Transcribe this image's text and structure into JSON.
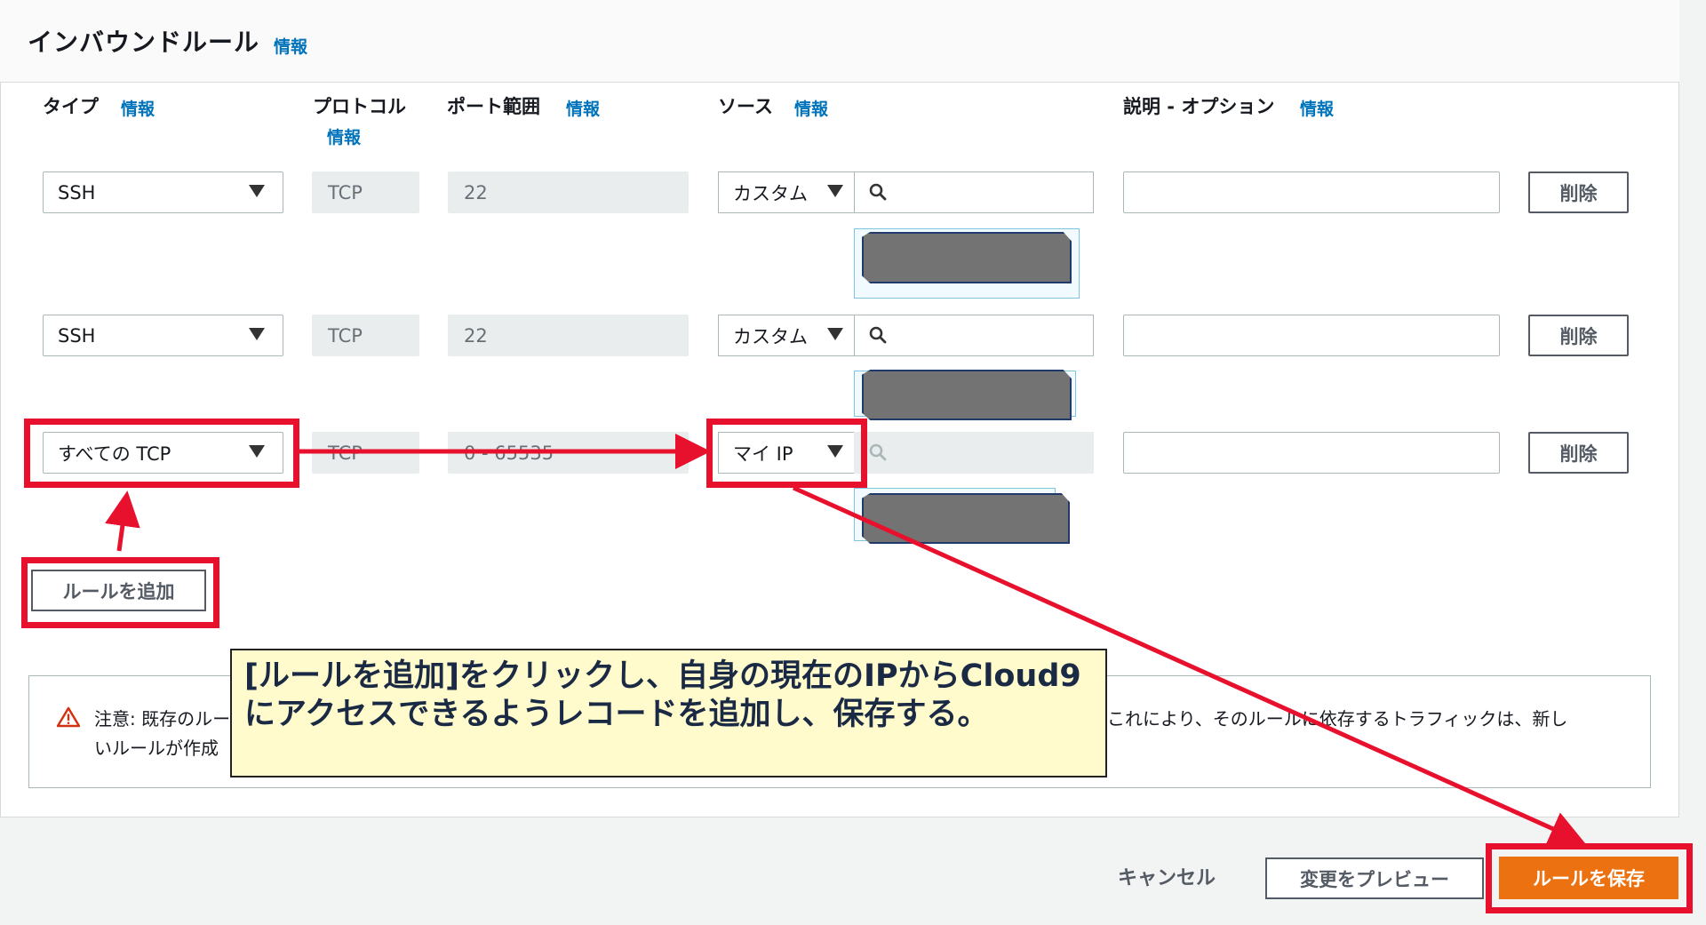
{
  "section": {
    "title": "インバウンドルール",
    "info": "情報"
  },
  "columns": {
    "type": "タイプ",
    "type_info": "情報",
    "protocol": "プロトコル",
    "protocol_info": "情報",
    "port": "ポート範囲",
    "port_info": "情報",
    "source": "ソース",
    "source_info": "情報",
    "description": "説明 - オプション",
    "description_info": "情報"
  },
  "rules": [
    {
      "type": "SSH",
      "protocol": "TCP",
      "port": "22",
      "source_type": "カスタム",
      "delete": "削除"
    },
    {
      "type": "SSH",
      "protocol": "TCP",
      "port": "22",
      "source_type": "カスタム",
      "delete": "削除"
    },
    {
      "type": "すべての TCP",
      "protocol": "TCP",
      "port": "0 - 65535",
      "source_type": "マイ IP",
      "delete": "削除"
    }
  ],
  "add_rule": "ルールを追加",
  "warning": {
    "line1": "注意: 既存のルー",
    "line1b": "これにより、そのルールに依存するトラフィックは、新し",
    "line2": "いルールが作成"
  },
  "callout": {
    "line1": "[ルールを追加]をクリックし、自身の現在のIPからCloud9",
    "line2": "にアクセスできるようレコードを追加し、保存する。"
  },
  "footer": {
    "cancel": "キャンセル",
    "preview": "変更をプレビュー",
    "save": "ルールを保存"
  },
  "colors": {
    "accent": "#ec7211",
    "link": "#0073bb",
    "annotation": "#e8112d",
    "callout_bg": "#fffbcc"
  }
}
